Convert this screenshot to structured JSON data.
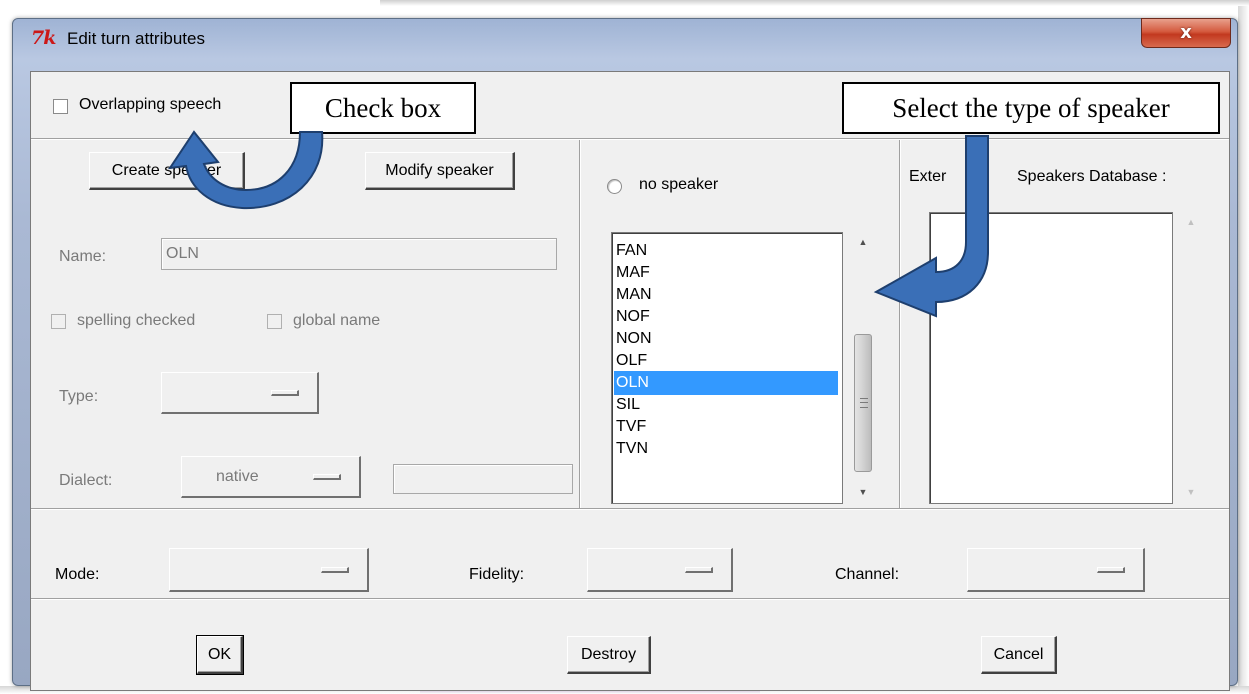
{
  "window": {
    "icon_text": "7k",
    "title": "Edit turn attributes",
    "close_glyph": "x"
  },
  "overlapping_speech": {
    "label": "Overlapping speech",
    "checked": false
  },
  "callouts": {
    "check_box": "Check box",
    "select_speaker": "Select the type of speaker"
  },
  "buttons": {
    "create_speaker": "Create speaker",
    "modify_speaker": "Modify speaker",
    "ok": "OK",
    "destroy": "Destroy",
    "cancel": "Cancel"
  },
  "speaker_form": {
    "name_label": "Name:",
    "name_value": "OLN",
    "spelling_checked_label": "spelling checked",
    "global_name_label": "global name",
    "type_label": "Type:",
    "type_value": "",
    "dialect_label": "Dialect:",
    "dialect_value": "native",
    "dialect_extra": ""
  },
  "speaker_list": {
    "no_speaker_label": "no speaker",
    "items": [
      "FAN",
      "MAF",
      "MAN",
      "NOF",
      "NON",
      "OLF",
      "OLN",
      "SIL",
      "TVF",
      "TVN"
    ],
    "selected": "OLN"
  },
  "external_db": {
    "label_visible_start": "Exter",
    "label_visible_end": "Speakers Database :",
    "items": []
  },
  "attributes": {
    "mode_label": "Mode:",
    "mode_value": "",
    "fidelity_label": "Fidelity:",
    "fidelity_value": "",
    "channel_label": "Channel:",
    "channel_value": ""
  },
  "icons": {
    "close": "close-icon",
    "app": "tk-feather-icon",
    "scroll_up": "scroll-up-arrow-icon",
    "scroll_down": "scroll-down-arrow-icon",
    "grip": "scroll-grip-icon"
  },
  "colors": {
    "selection": "#3399ff",
    "arrow_fill": "#3a6fb7",
    "close_button": "#c2391f",
    "title_gradient": "#b9c8e2"
  }
}
